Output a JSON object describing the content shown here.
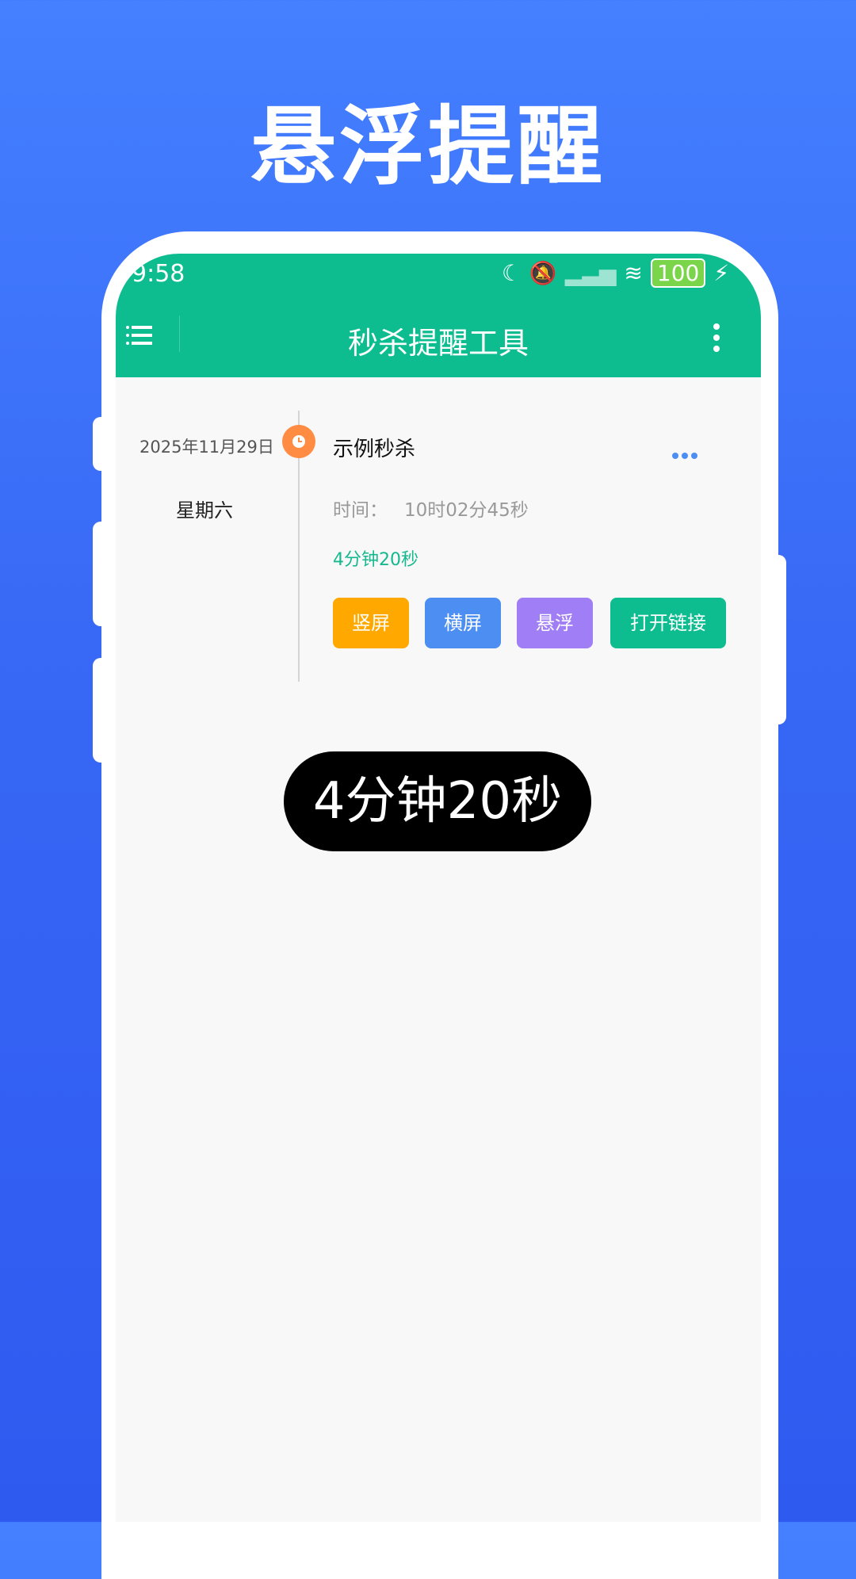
{
  "promo": {
    "headline": "悬浮提醒"
  },
  "statusbar": {
    "time": "9:58",
    "battery": "100",
    "icons": [
      "moon-icon",
      "vibrate-bell-off-icon",
      "signal-icon",
      "wifi-icon",
      "battery-icon",
      "charging-bolt-icon"
    ]
  },
  "appbar": {
    "title": "秒杀提醒工具",
    "menu_icon": "menu-icon",
    "overflow_icon": "more-vert-icon"
  },
  "reminder": {
    "date": "2025年11月29日",
    "weekday": "星期六",
    "title": "示例秒杀",
    "time_label": "时间：",
    "time_value": "10时02分45秒",
    "countdown": "4分钟20秒",
    "buttons": {
      "portrait": "竖屏",
      "landscape": "横屏",
      "float": "悬浮",
      "open_link": "打开链接"
    }
  },
  "toast": {
    "text": "4分钟20秒"
  },
  "colors": {
    "accent": "#0dbd90",
    "background_top": "#4480ff",
    "background_bottom": "#2f5af0",
    "portrait_button": "#ffa800",
    "landscape_button": "#4d8ef2",
    "float_button": "#a07ef5",
    "timeline_dot": "#ff8c42"
  }
}
